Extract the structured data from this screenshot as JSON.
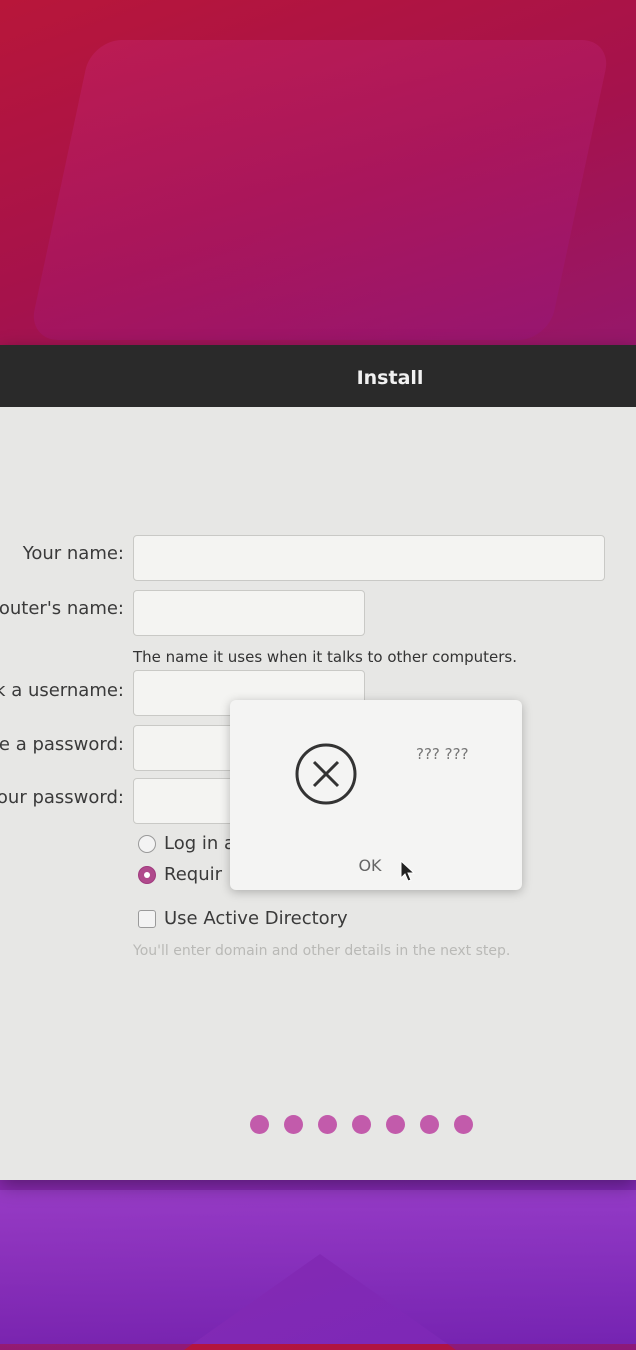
{
  "window": {
    "title": "Install"
  },
  "form": {
    "fields": [
      {
        "label": "Your name:",
        "value": ""
      },
      {
        "label": "outer's name:",
        "value": ""
      },
      {
        "label": "k a username:",
        "value": ""
      },
      {
        "label": "e a password:",
        "value": ""
      },
      {
        "label": "our password:",
        "value": ""
      }
    ],
    "computer_name_hint": "The name it uses when it talks to other computers.",
    "options": {
      "login_auto": "Log in a",
      "require_password": "Requir",
      "active_directory": "Use Active Directory"
    },
    "ad_hint": "You'll enter domain and other details in the next step."
  },
  "dialog": {
    "icon": "error-circle-x-icon",
    "message": "??? ???",
    "ok_label": "OK"
  },
  "progress": {
    "steps_total": 7
  },
  "colors": {
    "accent": "#c25bab",
    "titlebar": "#2a2a2a"
  }
}
